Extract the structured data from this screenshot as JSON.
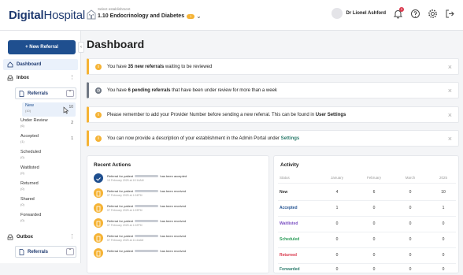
{
  "header": {
    "logo_main": "Digital",
    "logo_light": "Hospital",
    "establishment_label": "Select establishment",
    "establishment_name": "1.10 Endocrinology and Diabetes",
    "establishment_badge": "1",
    "user_name": "Dr Lionel Ashford",
    "notifications_count": "3"
  },
  "sidebar": {
    "new_referral": "+ New Referral",
    "dashboard": "Dashboard",
    "inbox": "Inbox",
    "referrals": "Referrals",
    "items": [
      {
        "label": "New",
        "count": "(10)",
        "num": "10"
      },
      {
        "label": "Under Review",
        "count": "(6)",
        "num": "2"
      },
      {
        "label": "Accepted",
        "count": "(1)",
        "num": "1"
      },
      {
        "label": "Scheduled",
        "count": "(0)",
        "num": ""
      },
      {
        "label": "Waitlisted",
        "count": "(0)",
        "num": ""
      },
      {
        "label": "Returned",
        "count": "(0)",
        "num": ""
      },
      {
        "label": "Shared",
        "count": "(0)",
        "num": ""
      },
      {
        "label": "Forwarded",
        "count": "(0)",
        "num": ""
      }
    ],
    "outbox": "Outbox",
    "outbox_referrals": "Referrals"
  },
  "main": {
    "title": "Dashboard",
    "notices": {
      "n1_pre": "You have ",
      "n1_bold": "35 new referrals",
      "n1_post": " waiting to be reviewed",
      "n2_pre": "You have ",
      "n2_bold": "6 pending referrals",
      "n2_post": " that have been under review for more than a week",
      "n3_pre": "Please remember to add your Provider Number before sending a new referral. This can be found in ",
      "n3_bold": "User Settings",
      "n4_pre": "You can now provide a description of your establishment in the Admin Portal under ",
      "n4_link": "Settings"
    },
    "recent_title": "Recent Actions",
    "recent": [
      {
        "pre": "Referral for patient",
        "post": "has been accepted",
        "date": "13 February 2025 at 10:14AM"
      },
      {
        "pre": "Referral for patient",
        "post": "has been received",
        "date": "07 February 2025 at 1:04PM"
      },
      {
        "pre": "Referral for patient",
        "post": "has been received",
        "date": "07 February 2025 at 1:03PM"
      },
      {
        "pre": "Referral for patient",
        "post": "has been received",
        "date": "07 February 2025 at 1:02PM"
      },
      {
        "pre": "Referral for patient",
        "post": "has been received",
        "date": "07 February 2025 at 11:44AM"
      },
      {
        "pre": "Referral for patient",
        "post": "has been received",
        "date": ""
      }
    ],
    "activity_title": "Activity",
    "activity_headers": [
      "Status",
      "January",
      "February",
      "March",
      "2025"
    ],
    "activity_rows": [
      {
        "status": "New",
        "color": "#222222",
        "vals": [
          "4",
          "6",
          "0",
          "10"
        ]
      },
      {
        "status": "Accepted",
        "color": "#1f4f8f",
        "vals": [
          "1",
          "0",
          "0",
          "1"
        ]
      },
      {
        "status": "Waitlisted",
        "color": "#7a4fc2",
        "vals": [
          "0",
          "0",
          "0",
          "0"
        ]
      },
      {
        "status": "Scheduled",
        "color": "#2e9d5b",
        "vals": [
          "0",
          "0",
          "0",
          "0"
        ]
      },
      {
        "status": "Returned",
        "color": "#d9364a",
        "vals": [
          "0",
          "0",
          "0",
          "0"
        ]
      },
      {
        "status": "Forwarded",
        "color": "#2f7d6e",
        "vals": [
          "0",
          "0",
          "0",
          "0"
        ]
      }
    ]
  }
}
